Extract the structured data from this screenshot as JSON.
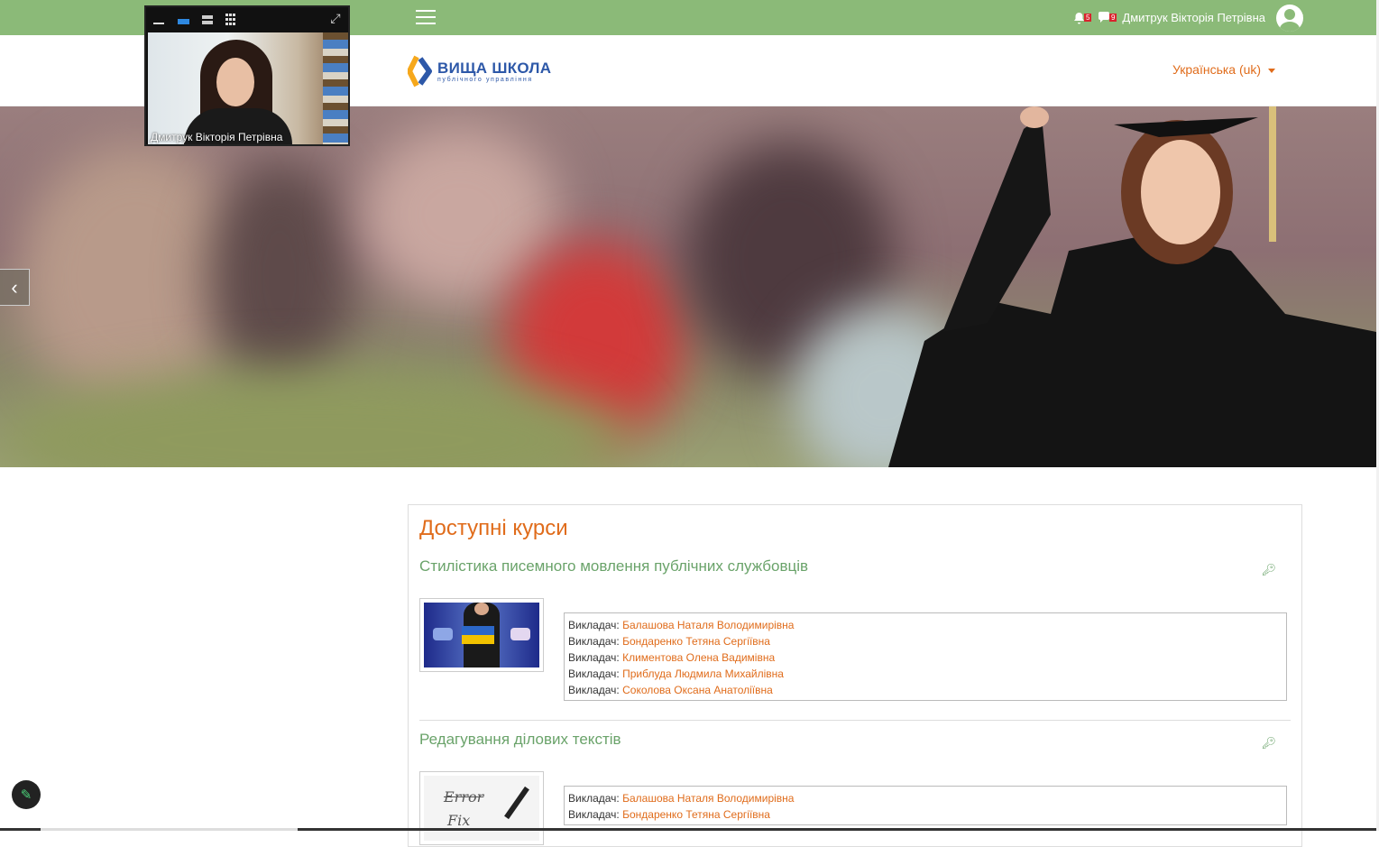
{
  "topbar": {
    "notifications_count": "5",
    "messages_count": "9",
    "user_name": "Дмитрук Вікторія Петрівна"
  },
  "header": {
    "logo_title": "ВИЩА ШКОЛА",
    "logo_subtitle": "публічного управління",
    "language": "Українська (uk)"
  },
  "video": {
    "participant_name": "Дмитрук Вікторія Петрівна"
  },
  "courses_section": {
    "title": "Доступні курси",
    "teacher_label": "Викладач:",
    "courses": [
      {
        "name": "Стилістика писемного мовлення публічних службовців",
        "teachers": [
          "Балашова Наталя Володимирівна",
          "Бондаренко Тетяна Сергіївна",
          "Климентова Олена Вадимівна",
          "Приблуда Людмила Михайлівна",
          "Соколова Оксана Анатоліївна"
        ]
      },
      {
        "name": "Редагування ділових текстів",
        "teachers": [
          "Балашова Наталя Володимирівна",
          "Бондаренко Тетяна Сергіївна"
        ],
        "thumb_text_1": "Error",
        "thumb_text_2": "Fix"
      }
    ]
  },
  "colors": {
    "topbar": "#8bba78",
    "accent": "#e06c1b",
    "course_link": "#6aa36a",
    "logo_blue": "#2d58a8"
  }
}
